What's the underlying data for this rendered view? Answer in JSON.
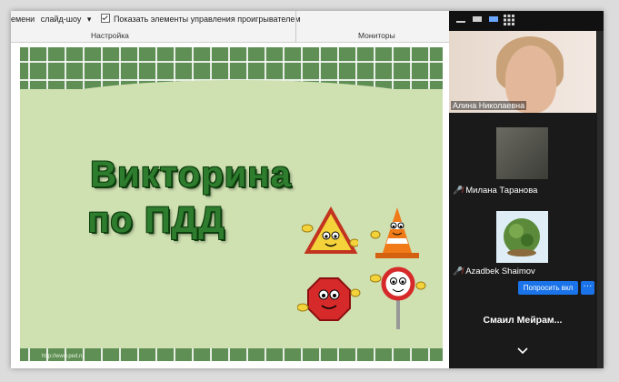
{
  "ribbon": {
    "partial_left": "емени",
    "slideshow": "слайд-шоу",
    "show_controls": "Показать элементы управления проигрывателем",
    "group_setup": "Настройка",
    "group_monitors": "Мониторы"
  },
  "slide": {
    "title_line1": "Викторина",
    "title_line2": "по ПДД",
    "footer_url": "http://www.ped.ru"
  },
  "participants": [
    {
      "name": "Алина Николаевна"
    },
    {
      "name": "Милана Таранова"
    },
    {
      "name": "Azadbek Shaimov"
    },
    {
      "name": "Смаил Мейрам..."
    }
  ],
  "buttons": {
    "ask_unmute": "Попросить вкл",
    "more": "···"
  },
  "colors": {
    "zoom_blue": "#1a73e8",
    "panel_bg": "#1a1a1a",
    "title_green": "#2e7d2e"
  }
}
